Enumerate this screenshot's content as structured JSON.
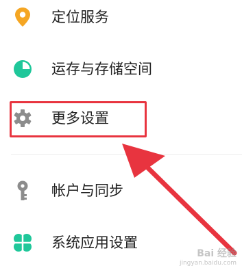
{
  "settings": {
    "items": [
      {
        "label": "定位服务",
        "icon": "location-pin-icon",
        "color": "#f5a623"
      },
      {
        "label": "运存与存储空间",
        "icon": "pie-chart-icon",
        "color": "#1fc79a"
      },
      {
        "label": "更多设置",
        "icon": "gear-icon",
        "color": "#8c8c8c"
      },
      {
        "label": "帐户与同步",
        "icon": "key-icon",
        "color": "#8c8c8c"
      },
      {
        "label": "系统应用设置",
        "icon": "clover-icon",
        "color": "#1fc79a"
      }
    ]
  },
  "annotation": {
    "highlight_color": "#e8343f",
    "highlighted_item": "更多设置"
  },
  "watermark": {
    "text": "Bai 经验",
    "sub": "jingyan.baidu.com"
  }
}
